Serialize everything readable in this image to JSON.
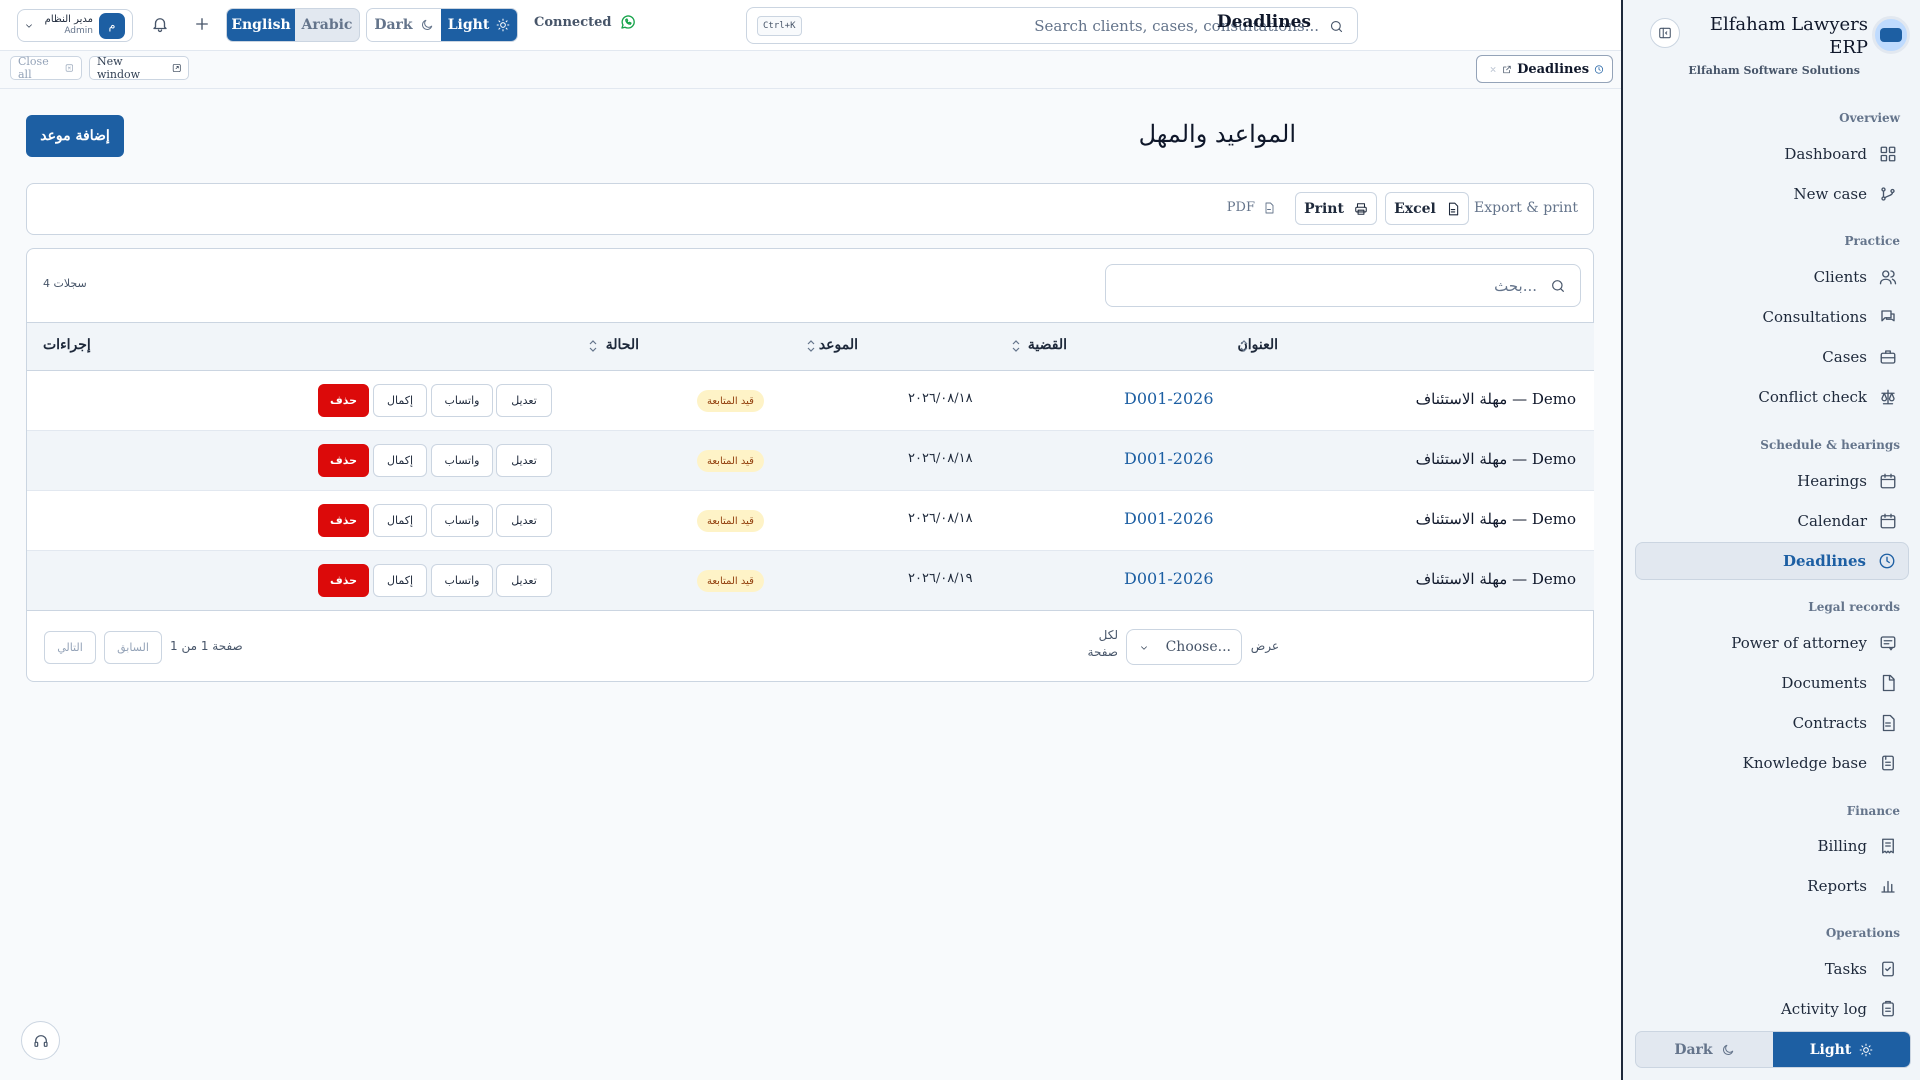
{
  "app": {
    "name": "Elfaham Lawyers ERP",
    "company": "Elfaham Software Solutions"
  },
  "topbar": {
    "user_initial": "م",
    "user_name": "مدير النظام",
    "user_role": "Admin",
    "lang_english": "English",
    "lang_arabic": "Arabic",
    "theme_dark": "Dark",
    "theme_light": "Light",
    "connection_status": "Connected",
    "search_placeholder": "Search clients, cases, consultations...",
    "search_shortcut": "Ctrl+K",
    "page_title": "Deadlines",
    "accent_color": "#1d5fa3"
  },
  "tabbar": {
    "close_all": "Close all",
    "new_window": "New window",
    "open_tab": "Deadlines"
  },
  "page": {
    "heading": "المواعيد والمهل",
    "add_button": "إضافة موعد",
    "export": {
      "label": "Export & print",
      "excel": "Excel",
      "print": "Print",
      "pdf": "PDF"
    },
    "table": {
      "search_placeholder": "بحث...",
      "record_count": "4 سجلات",
      "columns": {
        "title": "العنوان",
        "case": "القضية",
        "date": "الموعد",
        "status": "الحالة",
        "actions": "إجراءات"
      },
      "action_labels": {
        "edit": "تعديل",
        "whatsapp": "واتساب",
        "complete": "إكمال",
        "delete": "حذف"
      },
      "rows": [
        {
          "title": "مهلة الاستئناف — Demo",
          "case": "D001-2026",
          "date": "٢٠٢٦/٠٨/١٨",
          "status": "قيد المتابعة"
        },
        {
          "title": "مهلة الاستئناف — Demo",
          "case": "D001-2026",
          "date": "٢٠٢٦/٠٨/١٨",
          "status": "قيد المتابعة"
        },
        {
          "title": "مهلة الاستئناف — Demo",
          "case": "D001-2026",
          "date": "٢٠٢٦/٠٨/١٨",
          "status": "قيد المتابعة"
        },
        {
          "title": "مهلة الاستئناف — Demo",
          "case": "D001-2026",
          "date": "٢٠٢٦/٠٨/١٩",
          "status": "قيد المتابعة"
        }
      ],
      "pagination": {
        "show_label": "عرض",
        "per_page_select": "Choose...",
        "per_page_line1": "لكل",
        "per_page_line2": "صفحة",
        "page_info": "صفحة 1 من 1",
        "prev": "السابق",
        "next": "التالي"
      }
    }
  },
  "sidebar": {
    "sections": [
      {
        "title": "Overview",
        "items": [
          {
            "label": "Dashboard",
            "icon": "dashboard-icon"
          },
          {
            "label": "New case",
            "icon": "git-branch-icon"
          }
        ]
      },
      {
        "title": "Practice",
        "items": [
          {
            "label": "Clients",
            "icon": "users-icon"
          },
          {
            "label": "Consultations",
            "icon": "chat-icon"
          },
          {
            "label": "Cases",
            "icon": "briefcase-icon"
          },
          {
            "label": "Conflict check",
            "icon": "scale-icon"
          }
        ]
      },
      {
        "title": "Schedule & hearings",
        "items": [
          {
            "label": "Hearings",
            "icon": "calendar-icon"
          },
          {
            "label": "Calendar",
            "icon": "calendar-icon"
          },
          {
            "label": "Deadlines",
            "icon": "clock-icon",
            "active": true
          }
        ]
      },
      {
        "title": "Legal records",
        "items": [
          {
            "label": "Power of attorney",
            "icon": "stamp-icon"
          },
          {
            "label": "Documents",
            "icon": "file-icon"
          },
          {
            "label": "Contracts",
            "icon": "file-text-icon"
          },
          {
            "label": "Knowledge base",
            "icon": "book-icon"
          }
        ]
      },
      {
        "title": "Finance",
        "items": [
          {
            "label": "Billing",
            "icon": "receipt-icon"
          },
          {
            "label": "Reports",
            "icon": "bar-chart-icon"
          }
        ]
      },
      {
        "title": "Operations",
        "items": [
          {
            "label": "Tasks",
            "icon": "checklist-icon"
          },
          {
            "label": "Activity log",
            "icon": "clipboard-icon"
          }
        ]
      }
    ],
    "theme_dark": "Dark",
    "theme_light": "Light"
  }
}
